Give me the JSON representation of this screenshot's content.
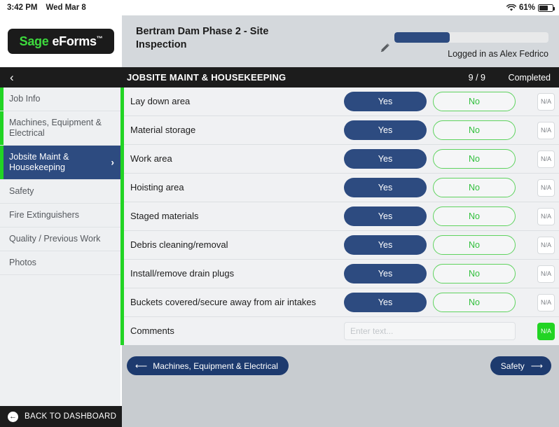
{
  "statusbar": {
    "time": "3:42 PM",
    "date": "Wed Mar 8",
    "battery_percent": "61%",
    "wifi_icon": "wifi-icon",
    "battery_icon": "battery-icon"
  },
  "brand": {
    "sage": "Sage",
    "eforms": "eForms",
    "tm": "™"
  },
  "header": {
    "form_title": "Bertram Dam Phase 2 - Site Inspection",
    "edit_icon": "pencil-icon",
    "progress_percent": 36,
    "logged_in": "Logged in as Alex Fedrico"
  },
  "sectionbar": {
    "back_icon": "chevron-left-icon",
    "title": "JOBSITE MAINT & HOUSEKEEPING",
    "count": "9 / 9",
    "status": "Completed"
  },
  "sidebar": {
    "items": [
      {
        "label": "Job Info",
        "active": false,
        "done": true
      },
      {
        "label": "Machines, Equipment & Electrical",
        "active": false,
        "done": true
      },
      {
        "label": "Jobsite Maint & Housekeeping",
        "active": true,
        "done": true,
        "chevron": "›"
      },
      {
        "label": "Safety",
        "active": false,
        "done": false
      },
      {
        "label": "Fire Extinguishers",
        "active": false,
        "done": false
      },
      {
        "label": "Quality / Previous Work",
        "active": false,
        "done": false
      },
      {
        "label": "Photos",
        "active": false,
        "done": false
      }
    ],
    "dashboard": {
      "label": "BACK TO DASHBOARD",
      "icon": "back-arrow-circle-icon"
    }
  },
  "options": {
    "yes": "Yes",
    "no": "No",
    "na": "N/A"
  },
  "questions": [
    {
      "label": "Lay down area",
      "answer": "yes"
    },
    {
      "label": "Material storage",
      "answer": "yes"
    },
    {
      "label": "Work area",
      "answer": "yes"
    },
    {
      "label": "Hoisting area",
      "answer": "yes"
    },
    {
      "label": "Staged materials",
      "answer": "yes"
    },
    {
      "label": "Debris cleaning/removal",
      "answer": "yes"
    },
    {
      "label": "Install/remove drain plugs",
      "answer": "yes"
    },
    {
      "label": "Buckets covered/secure away from air intakes",
      "answer": "yes"
    }
  ],
  "comments": {
    "label": "Comments",
    "value": "",
    "placeholder": "Enter text...",
    "na_label": "N/A",
    "na_active": true
  },
  "footer": {
    "prev_label": "Machines, Equipment & Electrical",
    "prev_icon": "arrow-left-icon",
    "next_label": "Safety",
    "next_icon": "arrow-right-icon"
  },
  "colors": {
    "navy": "#2d4b80",
    "navy_dark": "#1d3a6e",
    "green": "#22d424",
    "green_text": "#2fbf3a",
    "black": "#1c1c1c",
    "panel_gray": "#d4d8dc",
    "content_gray": "#f0f1f3"
  }
}
